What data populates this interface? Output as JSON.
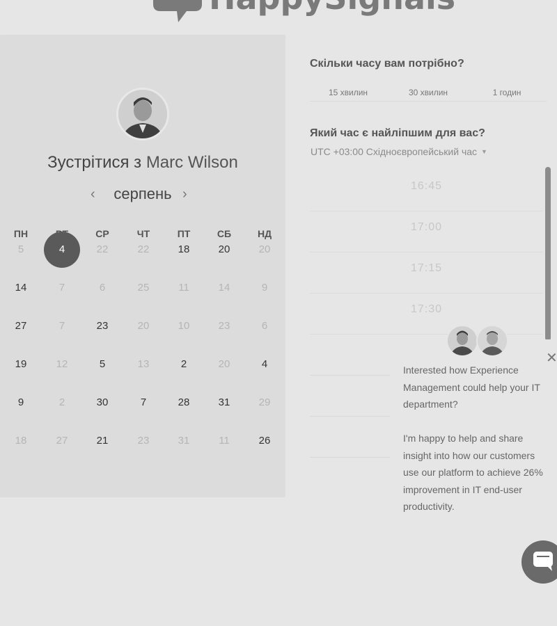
{
  "brand": {
    "logo_text": "HappySignals"
  },
  "calendar": {
    "host_prefix": "Зустрітися з ",
    "host_name": "Marc Wilson",
    "month": "серпень",
    "weekdays": [
      "ПН",
      "ВТ",
      "СР",
      "ЧТ",
      "ПТ",
      "СБ",
      "НД"
    ],
    "weeks": [
      [
        {
          "d": "5",
          "s": "off"
        },
        {
          "d": "4",
          "s": "selected"
        },
        {
          "d": "22",
          "s": "off"
        },
        {
          "d": "22",
          "s": "off"
        },
        {
          "d": "18",
          "s": "avail"
        },
        {
          "d": "20",
          "s": "avail"
        },
        {
          "d": "20",
          "s": "off"
        }
      ],
      [
        {
          "d": "14",
          "s": "avail"
        },
        {
          "d": "7",
          "s": "off"
        },
        {
          "d": "6",
          "s": "off"
        },
        {
          "d": "25",
          "s": "off"
        },
        {
          "d": "11",
          "s": "off"
        },
        {
          "d": "14",
          "s": "off"
        },
        {
          "d": "9",
          "s": "off"
        }
      ],
      [
        {
          "d": "27",
          "s": "avail"
        },
        {
          "d": "7",
          "s": "off"
        },
        {
          "d": "23",
          "s": "avail"
        },
        {
          "d": "20",
          "s": "off"
        },
        {
          "d": "10",
          "s": "off"
        },
        {
          "d": "23",
          "s": "off"
        },
        {
          "d": "6",
          "s": "off"
        }
      ],
      [
        {
          "d": "19",
          "s": "avail"
        },
        {
          "d": "12",
          "s": "off"
        },
        {
          "d": "5",
          "s": "avail"
        },
        {
          "d": "13",
          "s": "off"
        },
        {
          "d": "2",
          "s": "avail"
        },
        {
          "d": "20",
          "s": "off"
        },
        {
          "d": "4",
          "s": "avail"
        }
      ],
      [
        {
          "d": "9",
          "s": "avail"
        },
        {
          "d": "2",
          "s": "off"
        },
        {
          "d": "30",
          "s": "avail"
        },
        {
          "d": "7",
          "s": "avail"
        },
        {
          "d": "28",
          "s": "avail"
        },
        {
          "d": "31",
          "s": "avail"
        },
        {
          "d": "29",
          "s": "off"
        }
      ],
      [
        {
          "d": "18",
          "s": "off"
        },
        {
          "d": "27",
          "s": "off"
        },
        {
          "d": "21",
          "s": "avail"
        },
        {
          "d": "23",
          "s": "off"
        },
        {
          "d": "31",
          "s": "off"
        },
        {
          "d": "11",
          "s": "off"
        },
        {
          "d": "26",
          "s": "avail"
        }
      ]
    ]
  },
  "duration": {
    "question": "Скільки часу вам потрібно?",
    "options": [
      "15 хвилин",
      "30 хвилин",
      "1 годин"
    ]
  },
  "time": {
    "question": "Який час є найліпшим для вас?",
    "timezone": "UTC +03:00 Східноєвропейський час",
    "slots": [
      "16:45",
      "17:00",
      "17:15",
      "17:30",
      "",
      "",
      "",
      ""
    ]
  },
  "chat": {
    "message_1": "Interested how Experience Management could help your IT department?",
    "message_2": "I'm happy to help and share insight into how our customers use our platform to achieve 26% improvement in IT end-user productivity."
  },
  "colors": {
    "selected_day": "#5a5a5a",
    "background": "#e6e6e6",
    "panel": "#dcdcdc"
  }
}
